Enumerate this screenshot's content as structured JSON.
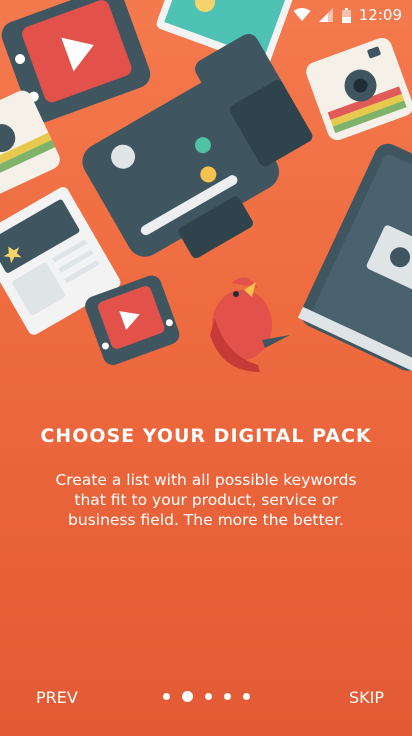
{
  "status": {
    "time": "12:09"
  },
  "onboarding": {
    "title": "CHOOSE YOUR DIGITAL PACK",
    "description_lines": [
      "Create a list with all possible keywords",
      "that fit to your product, service or",
      "business field. The more the better."
    ],
    "prev_label": "PREV",
    "skip_label": "SKIP",
    "page_index": 1,
    "page_count": 5
  },
  "colors": {
    "background_top": "#f47a4e",
    "background_bottom": "#e35a34",
    "device_dark": "#3f5560",
    "video_red": "#e2514a",
    "white": "#ffffff"
  },
  "icons": [
    "wifi-icon",
    "signal-icon",
    "battery-icon",
    "tv-video-icon",
    "film-camera-icon",
    "instant-camera-icon",
    "newspaper-icon",
    "tablet-icon",
    "bird-icon",
    "photo-icon"
  ]
}
